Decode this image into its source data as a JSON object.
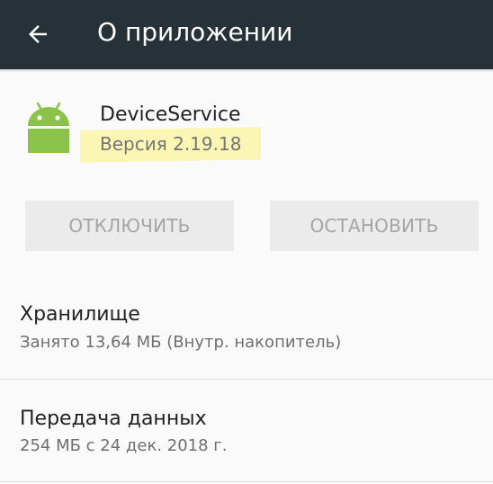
{
  "toolbar": {
    "title": "О приложении",
    "back_icon": "arrow-back-icon",
    "background_color": "#263238"
  },
  "app": {
    "name": "DeviceService",
    "version": "Версия 2.19.18",
    "icon": "android-icon",
    "icon_color": "#8bc34a",
    "highlight_color": "#fbf6b4"
  },
  "buttons": {
    "disable_label": "ОТКЛЮЧИТЬ",
    "stop_label": "ОСТАНОВИТЬ"
  },
  "storage": {
    "title": "Хранилище",
    "summary": "Занято 13,64 МБ (Внутр. накопитель)"
  },
  "data_usage": {
    "title": "Передача данных",
    "summary": "254 МБ с 24 дек. 2018 г."
  }
}
